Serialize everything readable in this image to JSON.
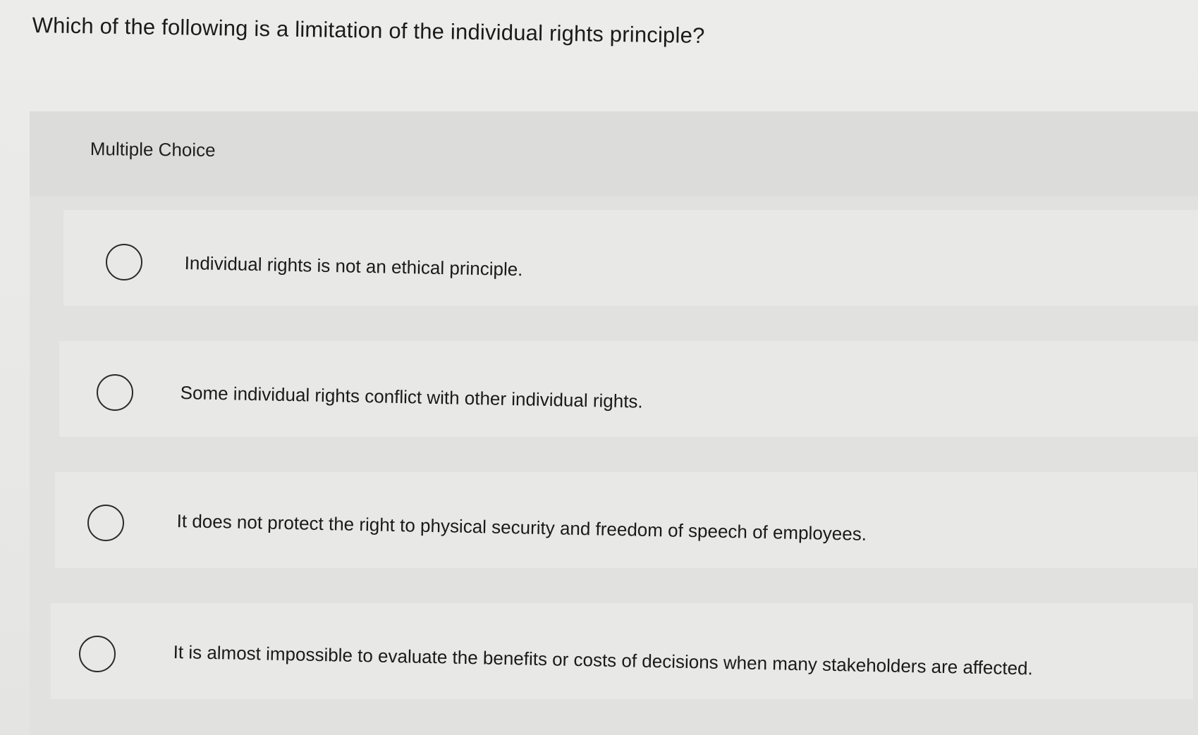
{
  "question": {
    "text": "Which of the following is a limitation of the individual rights principle?"
  },
  "panel": {
    "label": "Multiple Choice"
  },
  "options": [
    {
      "text": "Individual rights is not an ethical principle.",
      "selected": false
    },
    {
      "text": "Some individual rights conflict with other individual rights.",
      "selected": false
    },
    {
      "text": "It does not protect the right to physical security and freedom of speech of employees.",
      "selected": false
    },
    {
      "text": "It is almost impossible to evaluate the benefits or costs of decisions when many stakeholders are affected.",
      "selected": false
    }
  ]
}
